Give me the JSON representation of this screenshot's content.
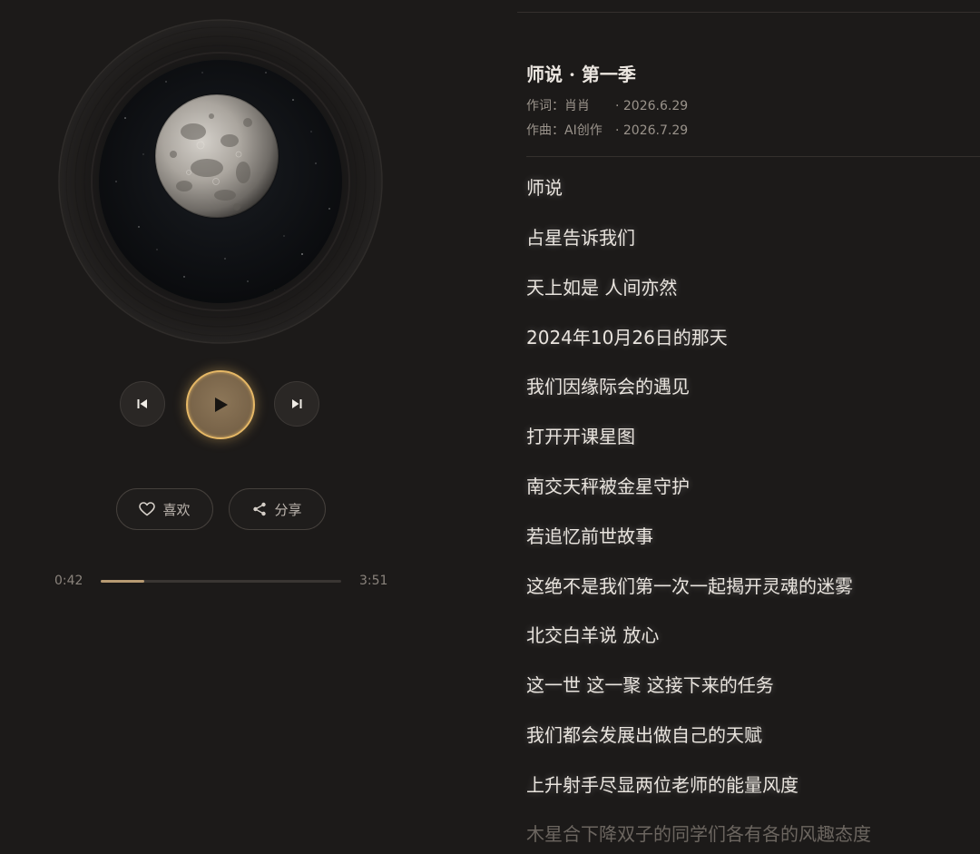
{
  "player": {
    "controls": {
      "prev_icon": "skip-previous-icon",
      "play_icon": "play-icon",
      "next_icon": "skip-next-icon"
    },
    "actions": {
      "like_icon": "heart-icon",
      "like_label": "喜欢",
      "share_icon": "share-icon",
      "share_label": "分享"
    },
    "progress": {
      "current": "0:42",
      "total": "3:51",
      "fraction": 0.18
    },
    "colors": {
      "accent": "#e6b866",
      "play_fill": "#7a654a",
      "progress_fill": "#b79a72"
    }
  },
  "song": {
    "title": "师说 · 第一季",
    "lyricist_label": "作词：",
    "lyricist": "肖肖",
    "lyricist_date": "· 2026.6.29",
    "composer_label": "作曲：",
    "composer": "AI创作",
    "composer_date": "· 2026.7.29"
  },
  "lyrics": [
    "师说",
    "占星告诉我们",
    "天上如是 人间亦然",
    "2024年10月26日的那天",
    "我们因缘际会的遇见",
    "打开开课星图",
    "南交天秤被金星守护",
    "若追忆前世故事",
    "这绝不是我们第一次一起揭开灵魂的迷雾",
    "北交白羊说 放心",
    "这一世 这一聚 这接下来的任务",
    "我们都会发展出做自己的天赋",
    "上升射手尽显两位老师的能量风度",
    "木星合下降双子的同学们各有各的风趣态度"
  ]
}
